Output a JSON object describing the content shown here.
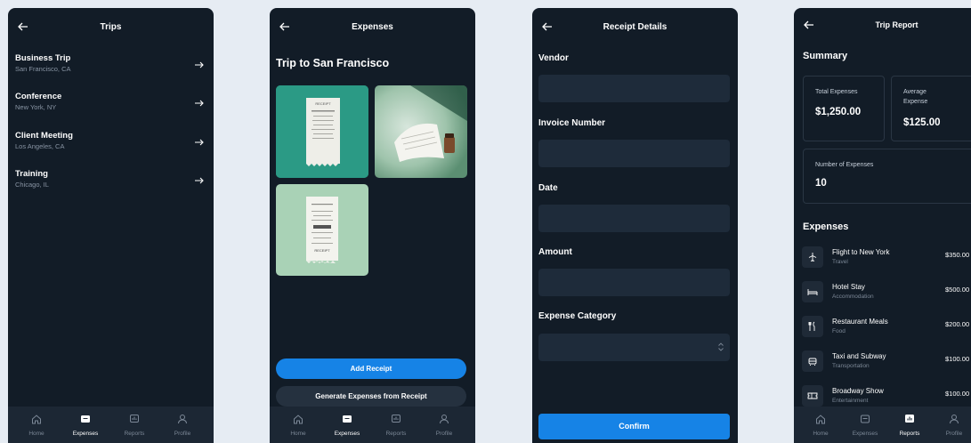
{
  "trips_screen": {
    "title": "Trips",
    "trips": [
      {
        "name": "Business Trip",
        "location": "San Francisco, CA"
      },
      {
        "name": "Conference",
        "location": "New York, NY"
      },
      {
        "name": "Client Meeting",
        "location": "Los Angeles, CA"
      },
      {
        "name": "Training",
        "location": "Chicago, IL"
      }
    ]
  },
  "expenses_screen": {
    "title": "Expenses",
    "trip_title": "Trip to San Francisco",
    "add_receipt_label": "Add Receipt",
    "generate_label": "Generate Expenses from Receipt",
    "receipt_texts": [
      "RECEIPT",
      "RECEIPT"
    ]
  },
  "receipt_screen": {
    "title": "Receipt Details",
    "fields": [
      {
        "label": "Vendor"
      },
      {
        "label": "Invoice Number"
      },
      {
        "label": "Date"
      },
      {
        "label": "Amount"
      },
      {
        "label": "Expense Category"
      }
    ],
    "confirm_label": "Confirm"
  },
  "report_screen": {
    "title": "Trip Report",
    "summary_heading": "Summary",
    "cards": [
      {
        "label": "Total Expenses",
        "value": "$1,250.00"
      },
      {
        "label": "Average Expense",
        "value": "$125.00"
      },
      {
        "label": "Number of Expenses",
        "value": "10"
      }
    ],
    "expenses_heading": "Expenses",
    "expenses": [
      {
        "name": "Flight to New York",
        "category": "Travel",
        "amount": "$350.00",
        "icon": "plane-icon"
      },
      {
        "name": "Hotel Stay",
        "category": "Accommodation",
        "amount": "$500.00",
        "icon": "bed-icon"
      },
      {
        "name": "Restaurant Meals",
        "category": "Food",
        "amount": "$200.00",
        "icon": "utensils-icon"
      },
      {
        "name": "Taxi and Subway",
        "category": "Transportation",
        "amount": "$100.00",
        "icon": "car-icon"
      },
      {
        "name": "Broadway Show",
        "category": "Entertainment",
        "amount": "$100.00",
        "icon": "ticket-icon"
      }
    ]
  },
  "nav": {
    "items": [
      {
        "label": "Home",
        "icon": "home-icon"
      },
      {
        "label": "Expenses",
        "icon": "receipt-icon"
      },
      {
        "label": "Reports",
        "icon": "chart-icon"
      },
      {
        "label": "Profile",
        "icon": "user-icon"
      }
    ]
  },
  "colors": {
    "background": "#e6ecf3",
    "screen": "#121c27",
    "input": "#1e2b3a",
    "accent": "#1683e6",
    "muted_text": "#8894a3"
  }
}
